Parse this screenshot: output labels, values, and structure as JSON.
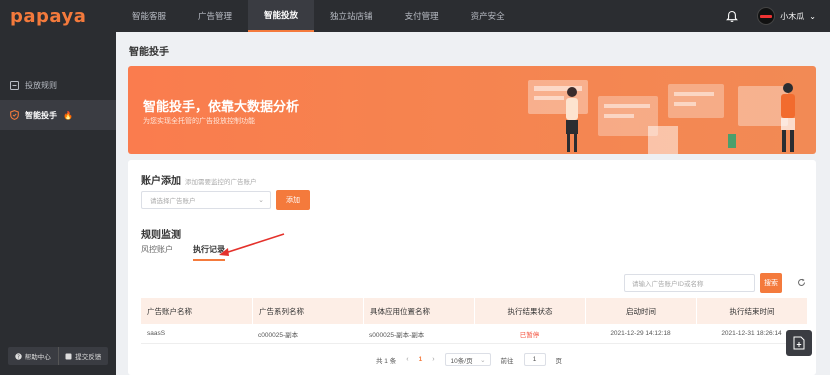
{
  "app": {
    "logo": "papaya"
  },
  "nav": [
    {
      "label": "智能客服"
    },
    {
      "label": "广告管理"
    },
    {
      "label": "智能投放"
    },
    {
      "label": "独立站店铺"
    },
    {
      "label": "支付管理"
    },
    {
      "label": "资产安全"
    }
  ],
  "user": {
    "name": "小木瓜"
  },
  "sidebar": {
    "items": [
      {
        "label": "投放规则"
      },
      {
        "label": "智能投手"
      }
    ],
    "help_label": "帮助中心",
    "feedback_label": "提交反馈"
  },
  "page": {
    "title": "智能投手"
  },
  "banner": {
    "title": "智能投手，依靠大数据分析",
    "subtitle": "为您实现全托管的广告投放控制功能"
  },
  "account_add": {
    "title": "账户添加",
    "hint": "添加需要监控的广告账户",
    "select_placeholder": "请选择广告账户",
    "add_label": "添加"
  },
  "rules": {
    "title": "规则监测",
    "tabs": [
      {
        "label": "风控账户"
      },
      {
        "label": "执行记录"
      }
    ],
    "search_placeholder": "请输入广告账户ID或名称",
    "search_label": "搜索"
  },
  "table": {
    "columns": [
      "广告账户名称",
      "广告系列名称",
      "具体应用位置名称",
      "执行结果状态",
      "启动时间",
      "执行结束时间"
    ],
    "rows": [
      [
        "saasS",
        "c000025-副本",
        "s000025-副本-副本",
        "已暂停",
        "2021-12-29 14:12:18",
        "2021-12-31 18:26:14"
      ]
    ]
  },
  "pagination": {
    "total_text": "共 1 条",
    "current": "1",
    "page_size": "10条/页",
    "goto_label": "前往",
    "goto_value": "1",
    "page_suffix": "页"
  },
  "colors": {
    "accent": "#f47a3c",
    "dark": "#2b2d31",
    "status_paused": "#f4513c"
  }
}
